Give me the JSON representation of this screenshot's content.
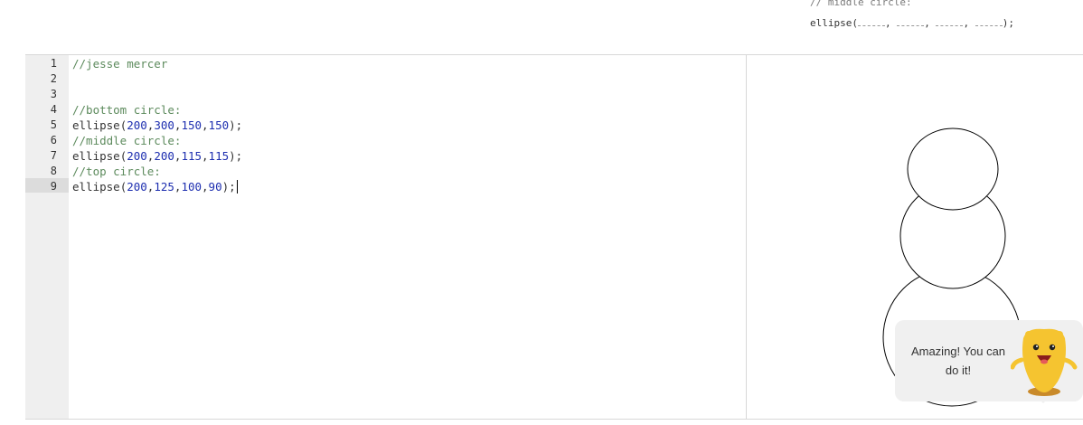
{
  "hint": {
    "comment": "// middle circle:",
    "call_prefix": "ellipse(",
    "sep": ",",
    "call_suffix": ");"
  },
  "editor": {
    "line_numbers": [
      "1",
      "2",
      "3",
      "4",
      "5",
      "6",
      "7",
      "8",
      "9"
    ],
    "lines": [
      {
        "type": "comment",
        "text": "//jesse mercer"
      },
      {
        "type": "blank",
        "text": ""
      },
      {
        "type": "blank",
        "text": ""
      },
      {
        "type": "comment",
        "text": "//bottom circle:"
      },
      {
        "type": "call",
        "fn": "ellipse",
        "args": [
          "200",
          "300",
          "150",
          "150"
        ]
      },
      {
        "type": "comment",
        "text": "//middle circle:"
      },
      {
        "type": "call",
        "fn": "ellipse",
        "args": [
          "200",
          "200",
          "115",
          "115"
        ]
      },
      {
        "type": "comment",
        "text": "//top circle:"
      },
      {
        "type": "call",
        "fn": "ellipse",
        "args": [
          "200",
          "125",
          "100",
          "90"
        ]
      }
    ],
    "active_line": 9
  },
  "bubble": {
    "line1": "Amazing! You can",
    "line2": "do it!"
  },
  "colors": {
    "comment": "#5c8a5c",
    "number": "#1e2fb0",
    "gutter": "#efefef",
    "mascot": "#f5c430"
  }
}
